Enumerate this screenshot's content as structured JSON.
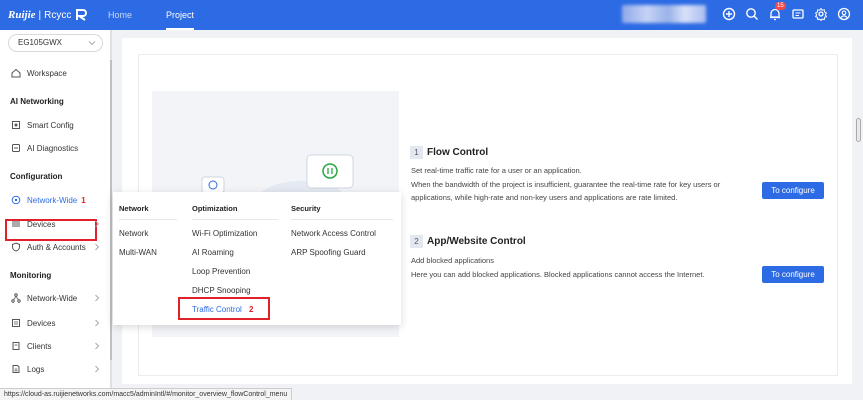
{
  "header": {
    "logo_brand": "Ruijie",
    "logo_product": "Rcycc",
    "nav_home": "Home",
    "nav_project": "Project",
    "notification_count": "15",
    "accent": "#2d6be4"
  },
  "sidebar": {
    "device": "EG105GWX",
    "workspace": "Workspace",
    "group_ai": "AI Networking",
    "smart_config": "Smart Config",
    "ai_diagnostics": "AI Diagnostics",
    "group_config": "Configuration",
    "network_wide": "Network-Wide",
    "network_wide_step": "1",
    "devices": "Devices",
    "auth_accounts": "Auth & Accounts",
    "group_monitoring": "Monitoring",
    "mon_network_wide": "Network-Wide",
    "mon_devices": "Devices",
    "mon_clients": "Clients",
    "mon_logs": "Logs"
  },
  "menu": {
    "col_network": "Network",
    "col_optimization": "Optimization",
    "col_security": "Security",
    "network_items": [
      "Network",
      "Multi-WAN"
    ],
    "optimization_items": [
      "Wi-Fi Optimization",
      "AI Roaming",
      "Loop Prevention",
      "DHCP Snooping",
      "Traffic Control"
    ],
    "traffic_control_step": "2",
    "security_items": [
      "Network Access Control",
      "ARP Spoofing Guard"
    ]
  },
  "content": {
    "flow": {
      "num": "1",
      "title": "Flow Control",
      "line1": "Set real-time traffic rate for a user or an application.",
      "line2": "When the bandwidth of the project is insufficient, guarantee the real-time rate for key users or",
      "line3": "applications, while high-rate and non-key users and applications are rate limited.",
      "button": "To configure"
    },
    "app": {
      "num": "2",
      "title": "App/Website Control",
      "line1": "Add blocked applications",
      "line2": "Here you can add blocked applications. Blocked applications cannot access the Internet.",
      "button": "To configure"
    }
  },
  "status_url": "https://cloud-as.ruijienetworks.com/macc5/adminIntl/#/monitor_overview_flowControl_menu"
}
